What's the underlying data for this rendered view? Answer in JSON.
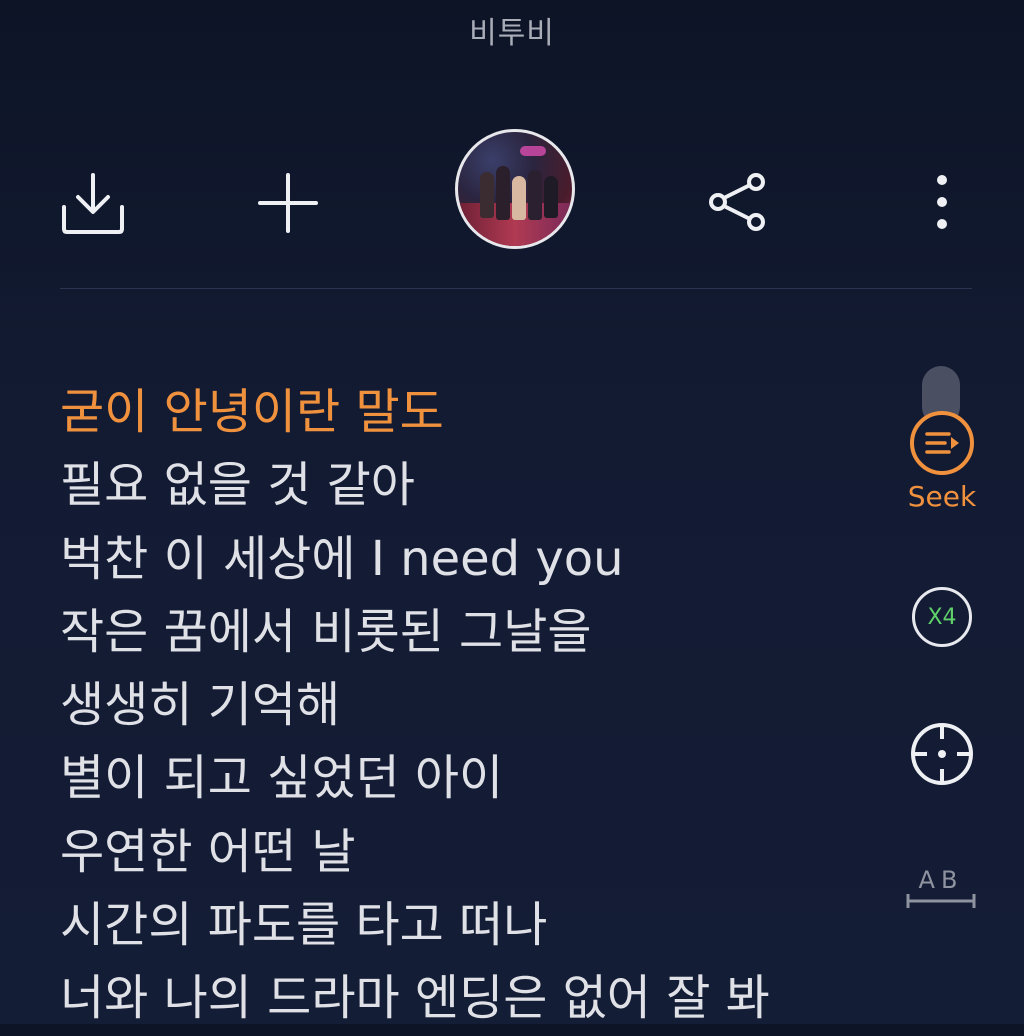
{
  "header": {
    "artist": "비투비"
  },
  "toolbar": {
    "download_icon": "download-icon",
    "add_icon": "plus-icon",
    "share_icon": "share-icon",
    "more_icon": "more-vertical-icon"
  },
  "lyrics": {
    "lines": [
      "굳이 안녕이란 말도",
      "필요 없을 것 같아",
      "벅찬 이 세상에 I need you",
      "작은 꿈에서 비롯된 그날을",
      "생생히 기억해",
      "별이 되고 싶었던 아이",
      "우연한 어떤 날",
      "시간의 파도를 타고 떠나",
      "너와 나의 드라마 엔딩은 없어 잘 봐"
    ],
    "active_index": 0,
    "active_color": "#f0913e"
  },
  "side_controls": {
    "seek_label": "Seek",
    "speed_label": "X4",
    "ab_label": "AB"
  }
}
